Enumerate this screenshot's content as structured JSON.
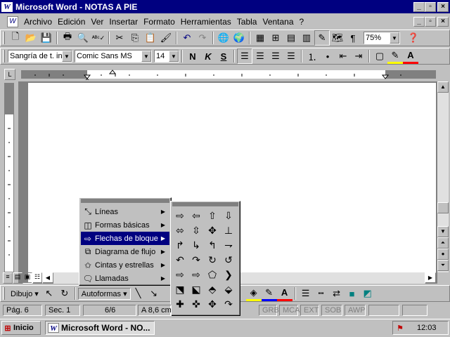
{
  "window": {
    "title": "Microsoft Word - NOTAS A PIE",
    "min": "_",
    "max": "▫",
    "close": "×"
  },
  "menubar": [
    "Archivo",
    "Edición",
    "Ver",
    "Insertar",
    "Formato",
    "Herramientas",
    "Tabla",
    "Ventana",
    "?"
  ],
  "standard_toolbar": {
    "zoom": "75%"
  },
  "format_toolbar": {
    "style": "Sangría de t. inde",
    "font": "Comic Sans MS",
    "size": "14",
    "bold": "N",
    "italic": "K",
    "underline": "S"
  },
  "draw_toolbar": {
    "draw": "Dibujo ▾",
    "autoshapes": "Autoformas ▾"
  },
  "autoshapes_menu": {
    "items": [
      {
        "label": "Líneas",
        "icon": "lines-icon"
      },
      {
        "label": "Formas básicas",
        "icon": "basic-shapes-icon"
      },
      {
        "label": "Flechas de bloque",
        "icon": "block-arrows-icon",
        "selected": true
      },
      {
        "label": "Diagrama de flujo",
        "icon": "flowchart-icon"
      },
      {
        "label": "Cintas y estrellas",
        "icon": "stars-icon"
      },
      {
        "label": "Llamadas",
        "icon": "callouts-icon"
      }
    ]
  },
  "block_arrows": [
    "⇨",
    "⇦",
    "⇧",
    "⇩",
    "⬄",
    "⇳",
    "✥",
    "⊥",
    "↱",
    "↳",
    "↰",
    "⇁",
    "↶",
    "↷",
    "↻",
    "↺",
    "⇨",
    "⇨",
    "⬠",
    "❯",
    "⬔",
    "⬕",
    "⬘",
    "⬙",
    "✚",
    "✜",
    "✥",
    "↷"
  ],
  "status": {
    "page": "Pág. 6",
    "section": "Sec. 1",
    "pages": "6/6",
    "at": "A 8,6 cm",
    "grb": "GRB",
    "mca": "MCA",
    "ext": "EXT",
    "sob": "SOB",
    "awp": "AWP"
  },
  "taskbar": {
    "start": "Inicio",
    "task": "Microsoft Word - NO...",
    "clock": "12:03"
  },
  "colors": {
    "title": "#000080",
    "face": "#c0c0c0",
    "selected": "#000080"
  }
}
